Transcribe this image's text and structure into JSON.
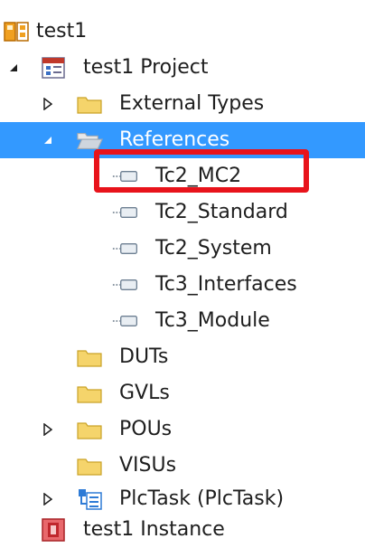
{
  "tree": {
    "solution": {
      "label": "test1",
      "icon": "plc-project-icon"
    },
    "project": {
      "label": "test1 Project",
      "icon": "project-icon"
    },
    "external_types": {
      "label": "External Types",
      "icon": "folder-icon"
    },
    "references": {
      "label": "References",
      "icon": "folder-open-icon"
    },
    "ref_items": [
      {
        "label": "Tc2_MC2",
        "icon": "library-reference-icon"
      },
      {
        "label": "Tc2_Standard",
        "icon": "library-reference-icon"
      },
      {
        "label": "Tc2_System",
        "icon": "library-reference-icon"
      },
      {
        "label": "Tc3_Interfaces",
        "icon": "library-reference-icon"
      },
      {
        "label": "Tc3_Module",
        "icon": "library-reference-icon"
      }
    ],
    "duts": {
      "label": "DUTs",
      "icon": "folder-icon"
    },
    "gvls": {
      "label": "GVLs",
      "icon": "folder-icon"
    },
    "pous": {
      "label": "POUs",
      "icon": "folder-icon"
    },
    "visus": {
      "label": "VISUs",
      "icon": "folder-icon"
    },
    "plctask": {
      "label": "PlcTask (PlcTask)",
      "icon": "task-icon"
    },
    "instance": {
      "label": "test1 Instance",
      "icon": "instance-icon"
    }
  },
  "colors": {
    "selection": "#3399ff",
    "highlight": "#e8131b",
    "folder": "#f5d46b"
  }
}
